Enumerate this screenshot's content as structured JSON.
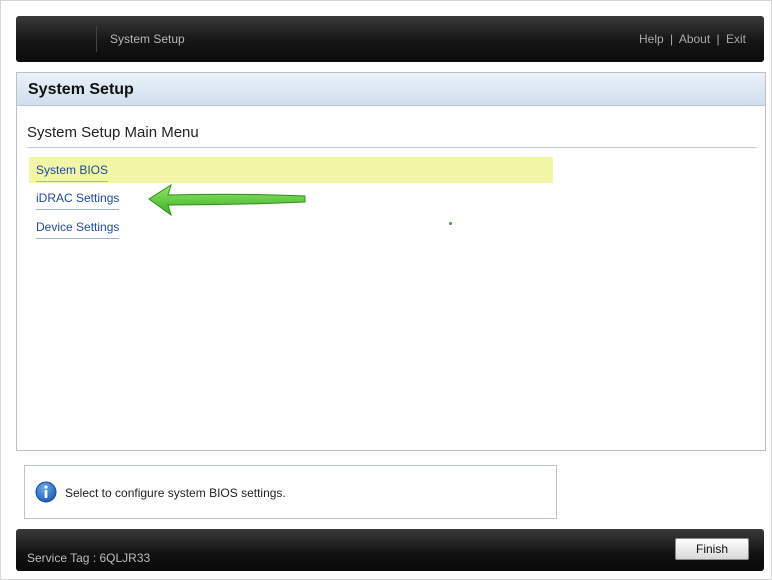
{
  "header": {
    "title": "System Setup",
    "links": [
      "Help",
      "About",
      "Exit"
    ],
    "separator": "|"
  },
  "panel": {
    "title": "System Setup",
    "menu_heading": "System Setup Main Menu",
    "items": [
      {
        "label": "System BIOS",
        "selected": true
      },
      {
        "label": "iDRAC Settings",
        "selected": false
      },
      {
        "label": "Device Settings",
        "selected": false
      }
    ]
  },
  "help_box": {
    "icon": "info-icon",
    "message": "Select to configure system BIOS settings."
  },
  "footer": {
    "service_tag": "Service Tag : 6QLJR33",
    "finish_label": "Finish"
  },
  "annotation": {
    "icon": "green-arrow-icon",
    "color": "#5cc43c"
  },
  "colors": {
    "selected_row": "#f2f5a6",
    "link": "#1e4aa8",
    "header_gradient_top": "#eaf2fa"
  }
}
